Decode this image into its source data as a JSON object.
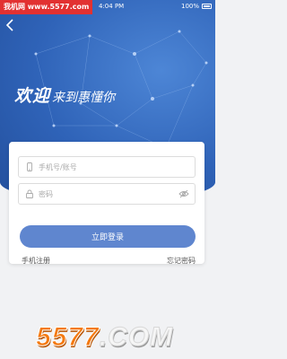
{
  "status_bar": {
    "time": "4:04 PM",
    "battery": "100%"
  },
  "watermark": "我机网 www.5577.com",
  "header": {
    "welcome_main": "欢迎",
    "welcome_sub": "来到惠懂你"
  },
  "form": {
    "username_placeholder": "手机号/账号",
    "password_placeholder": "密码",
    "login_label": "立即登录",
    "register_label": "手机注册",
    "forgot_label": "忘记密码"
  },
  "logo_banner": {
    "number": "5577",
    "domain": ".COM"
  },
  "colors": {
    "hero": "#2f63b8",
    "button": "#5f86cf",
    "background": "#f1f2f4",
    "logo_orange": "#f47a12"
  },
  "icons": [
    "back-icon",
    "phone-icon",
    "lock-icon",
    "eye-off-icon",
    "battery-icon"
  ]
}
